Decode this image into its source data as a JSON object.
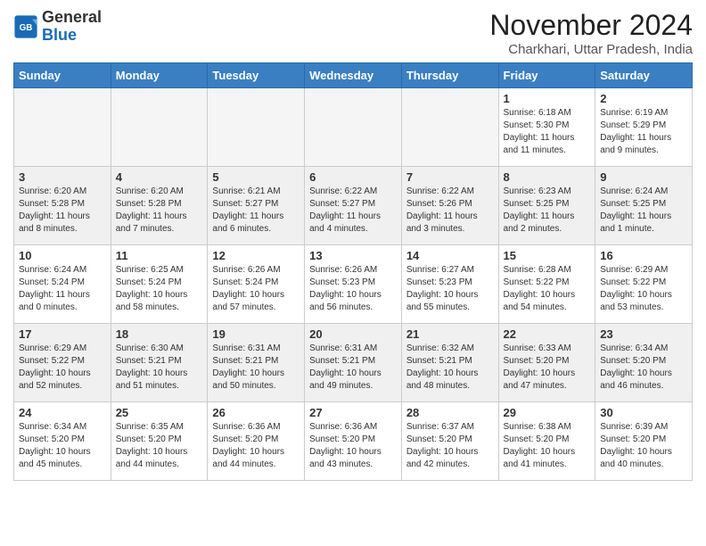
{
  "header": {
    "logo_line1": "General",
    "logo_line2": "Blue",
    "month_year": "November 2024",
    "location": "Charkhari, Uttar Pradesh, India"
  },
  "weekdays": [
    "Sunday",
    "Monday",
    "Tuesday",
    "Wednesday",
    "Thursday",
    "Friday",
    "Saturday"
  ],
  "weeks": [
    [
      {
        "day": "",
        "info": ""
      },
      {
        "day": "",
        "info": ""
      },
      {
        "day": "",
        "info": ""
      },
      {
        "day": "",
        "info": ""
      },
      {
        "day": "",
        "info": ""
      },
      {
        "day": "1",
        "info": "Sunrise: 6:18 AM\nSunset: 5:30 PM\nDaylight: 11 hours\nand 11 minutes."
      },
      {
        "day": "2",
        "info": "Sunrise: 6:19 AM\nSunset: 5:29 PM\nDaylight: 11 hours\nand 9 minutes."
      }
    ],
    [
      {
        "day": "3",
        "info": "Sunrise: 6:20 AM\nSunset: 5:28 PM\nDaylight: 11 hours\nand 8 minutes."
      },
      {
        "day": "4",
        "info": "Sunrise: 6:20 AM\nSunset: 5:28 PM\nDaylight: 11 hours\nand 7 minutes."
      },
      {
        "day": "5",
        "info": "Sunrise: 6:21 AM\nSunset: 5:27 PM\nDaylight: 11 hours\nand 6 minutes."
      },
      {
        "day": "6",
        "info": "Sunrise: 6:22 AM\nSunset: 5:27 PM\nDaylight: 11 hours\nand 4 minutes."
      },
      {
        "day": "7",
        "info": "Sunrise: 6:22 AM\nSunset: 5:26 PM\nDaylight: 11 hours\nand 3 minutes."
      },
      {
        "day": "8",
        "info": "Sunrise: 6:23 AM\nSunset: 5:25 PM\nDaylight: 11 hours\nand 2 minutes."
      },
      {
        "day": "9",
        "info": "Sunrise: 6:24 AM\nSunset: 5:25 PM\nDaylight: 11 hours\nand 1 minute."
      }
    ],
    [
      {
        "day": "10",
        "info": "Sunrise: 6:24 AM\nSunset: 5:24 PM\nDaylight: 11 hours\nand 0 minutes."
      },
      {
        "day": "11",
        "info": "Sunrise: 6:25 AM\nSunset: 5:24 PM\nDaylight: 10 hours\nand 58 minutes."
      },
      {
        "day": "12",
        "info": "Sunrise: 6:26 AM\nSunset: 5:24 PM\nDaylight: 10 hours\nand 57 minutes."
      },
      {
        "day": "13",
        "info": "Sunrise: 6:26 AM\nSunset: 5:23 PM\nDaylight: 10 hours\nand 56 minutes."
      },
      {
        "day": "14",
        "info": "Sunrise: 6:27 AM\nSunset: 5:23 PM\nDaylight: 10 hours\nand 55 minutes."
      },
      {
        "day": "15",
        "info": "Sunrise: 6:28 AM\nSunset: 5:22 PM\nDaylight: 10 hours\nand 54 minutes."
      },
      {
        "day": "16",
        "info": "Sunrise: 6:29 AM\nSunset: 5:22 PM\nDaylight: 10 hours\nand 53 minutes."
      }
    ],
    [
      {
        "day": "17",
        "info": "Sunrise: 6:29 AM\nSunset: 5:22 PM\nDaylight: 10 hours\nand 52 minutes."
      },
      {
        "day": "18",
        "info": "Sunrise: 6:30 AM\nSunset: 5:21 PM\nDaylight: 10 hours\nand 51 minutes."
      },
      {
        "day": "19",
        "info": "Sunrise: 6:31 AM\nSunset: 5:21 PM\nDaylight: 10 hours\nand 50 minutes."
      },
      {
        "day": "20",
        "info": "Sunrise: 6:31 AM\nSunset: 5:21 PM\nDaylight: 10 hours\nand 49 minutes."
      },
      {
        "day": "21",
        "info": "Sunrise: 6:32 AM\nSunset: 5:21 PM\nDaylight: 10 hours\nand 48 minutes."
      },
      {
        "day": "22",
        "info": "Sunrise: 6:33 AM\nSunset: 5:20 PM\nDaylight: 10 hours\nand 47 minutes."
      },
      {
        "day": "23",
        "info": "Sunrise: 6:34 AM\nSunset: 5:20 PM\nDaylight: 10 hours\nand 46 minutes."
      }
    ],
    [
      {
        "day": "24",
        "info": "Sunrise: 6:34 AM\nSunset: 5:20 PM\nDaylight: 10 hours\nand 45 minutes."
      },
      {
        "day": "25",
        "info": "Sunrise: 6:35 AM\nSunset: 5:20 PM\nDaylight: 10 hours\nand 44 minutes."
      },
      {
        "day": "26",
        "info": "Sunrise: 6:36 AM\nSunset: 5:20 PM\nDaylight: 10 hours\nand 44 minutes."
      },
      {
        "day": "27",
        "info": "Sunrise: 6:36 AM\nSunset: 5:20 PM\nDaylight: 10 hours\nand 43 minutes."
      },
      {
        "day": "28",
        "info": "Sunrise: 6:37 AM\nSunset: 5:20 PM\nDaylight: 10 hours\nand 42 minutes."
      },
      {
        "day": "29",
        "info": "Sunrise: 6:38 AM\nSunset: 5:20 PM\nDaylight: 10 hours\nand 41 minutes."
      },
      {
        "day": "30",
        "info": "Sunrise: 6:39 AM\nSunset: 5:20 PM\nDaylight: 10 hours\nand 40 minutes."
      }
    ]
  ],
  "colors": {
    "header_bg": "#3a7fc1",
    "accent": "#1a6bb5"
  }
}
